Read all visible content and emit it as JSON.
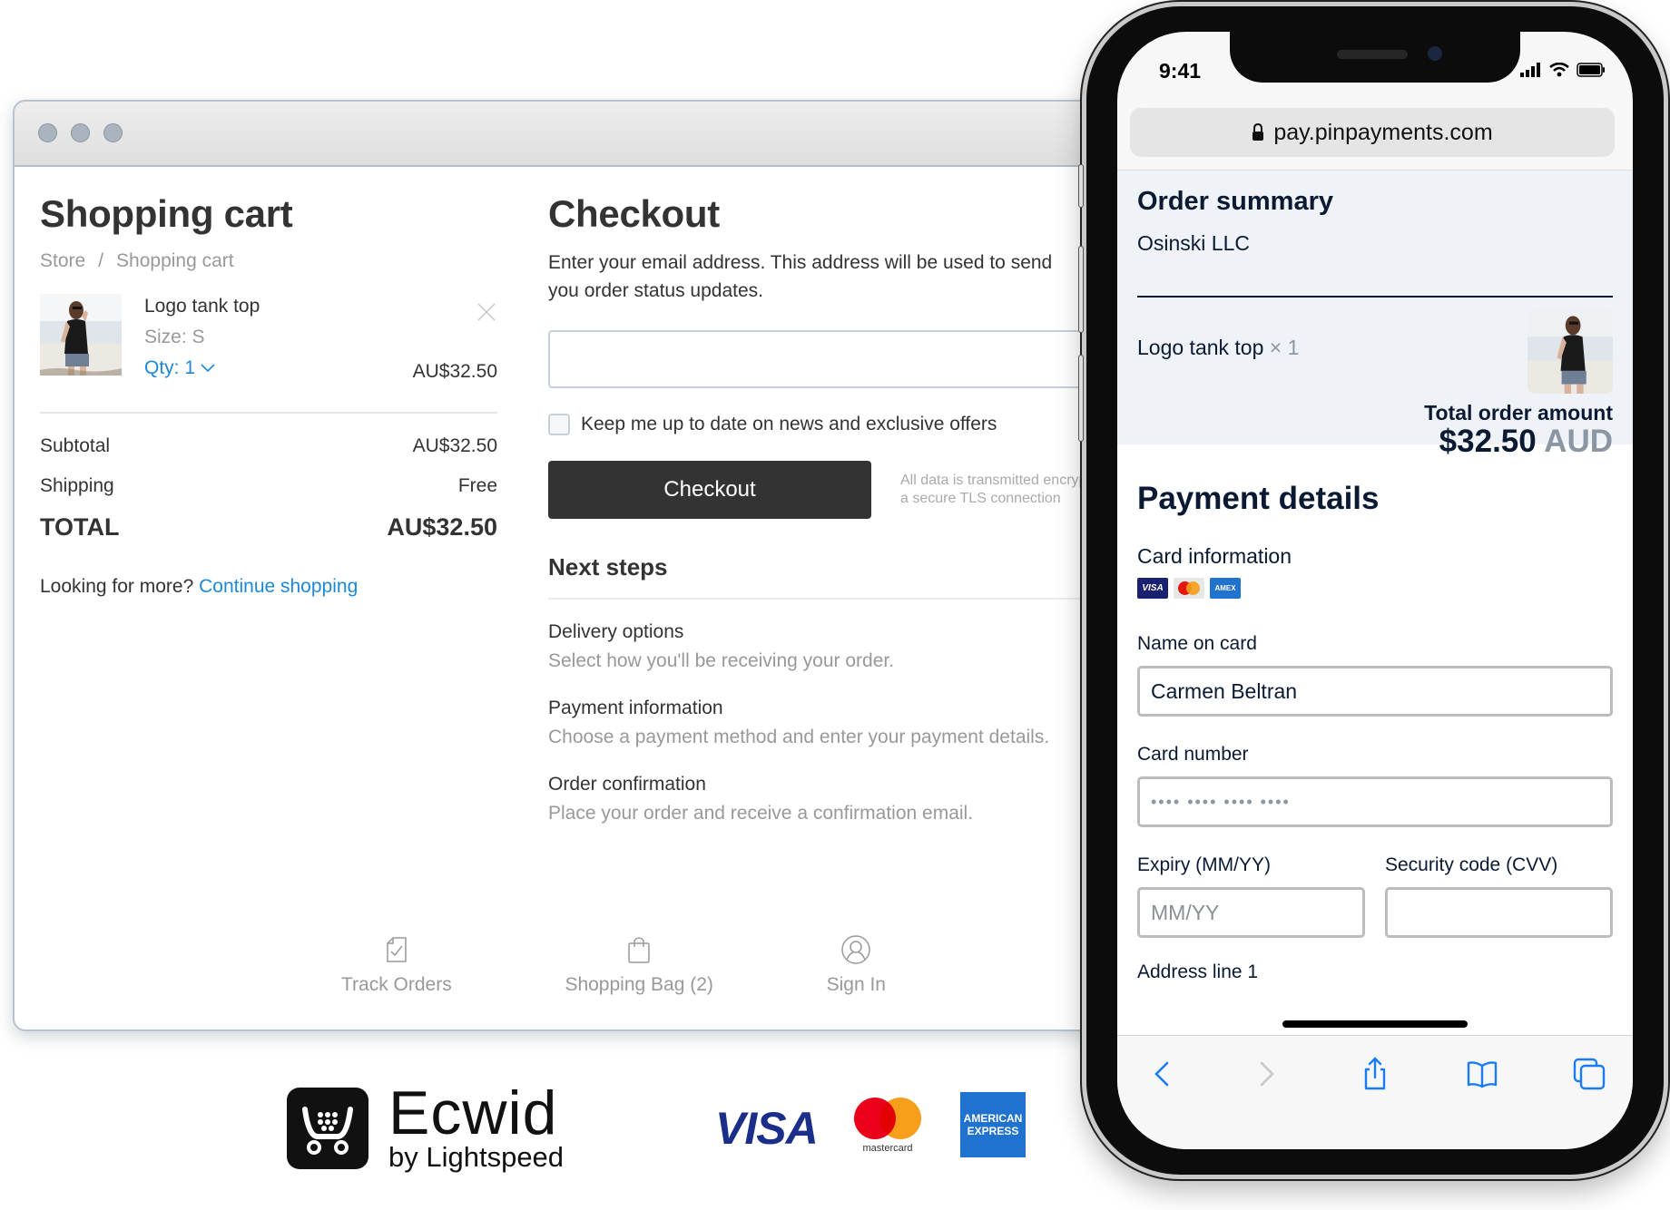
{
  "browser": {
    "window_controls": [
      "close",
      "minimize",
      "maximize"
    ]
  },
  "cart": {
    "title": "Shopping cart",
    "breadcrumb": [
      "Store",
      "Shopping cart"
    ],
    "breadcrumb_separator": "/",
    "item": {
      "name": "Logo tank top",
      "size": "Size: S",
      "qty": "Qty: 1",
      "price": "AU$32.50"
    },
    "subtotal_label": "Subtotal",
    "subtotal_value": "AU$32.50",
    "shipping_label": "Shipping",
    "shipping_value": "Free",
    "total_label": "TOTAL",
    "total_value": "AU$32.50",
    "more_prompt": "Looking for more?",
    "continue_link": "Continue shopping",
    "link_color": "#1e88d8"
  },
  "checkout": {
    "title": "Checkout",
    "description": "Enter your email address. This address will be used to send you order status updates.",
    "email_value": "",
    "newsletter_label": "Keep me up to date on news and exclusive offers",
    "newsletter_checked": false,
    "button_label": "Checkout",
    "secure_note_line1": "All data is transmitted encrypted via",
    "secure_note_line2": "a secure TLS connection",
    "next_steps_title": "Next steps",
    "steps": [
      {
        "title": "Delivery options",
        "desc": "Select how you'll be receiving your order."
      },
      {
        "title": "Payment information",
        "desc": "Choose a payment method and enter your payment details."
      },
      {
        "title": "Order confirmation",
        "desc": "Place your order and receive a confirmation email."
      }
    ]
  },
  "footer_nav": [
    {
      "label": "Track Orders",
      "icon": "track-orders-icon"
    },
    {
      "label": "Shopping Bag (2)",
      "icon": "shopping-bag-icon"
    },
    {
      "label": "Sign In",
      "icon": "user-icon"
    }
  ],
  "logos": {
    "ecwid_name": "Ecwid",
    "ecwid_tagline": "by Lightspeed",
    "visa": "VISA",
    "mastercard": "mastercard",
    "amex_line1": "AMERICAN",
    "amex_line2": "EXPRESS"
  },
  "phone": {
    "status_time": "9:41",
    "url": "pay.pinpayments.com",
    "order_summary": {
      "title": "Order summary",
      "merchant": "Osinski LLC",
      "item_name": "Logo tank top",
      "item_qty": "× 1",
      "total_label": "Total order amount",
      "total_amount": "$32.50",
      "total_currency": "AUD"
    },
    "payment": {
      "title": "Payment details",
      "card_info_label": "Card information",
      "card_brands": [
        "VISA",
        "Mastercard",
        "AMEX"
      ],
      "name_label": "Name on card",
      "name_value": "Carmen Beltran",
      "card_number_label": "Card number",
      "card_number_placeholder": "•••• •••• •••• ••••",
      "expiry_label": "Expiry (MM/YY)",
      "expiry_placeholder": "MM/YY",
      "cvv_label": "Security code (CVV)",
      "cvv_value": "",
      "address_label": "Address line 1"
    },
    "toolbar": [
      "back",
      "forward",
      "share",
      "bookmarks",
      "tabs"
    ],
    "accent_color": "#1a7cf5",
    "text_color": "#0a1a33"
  }
}
